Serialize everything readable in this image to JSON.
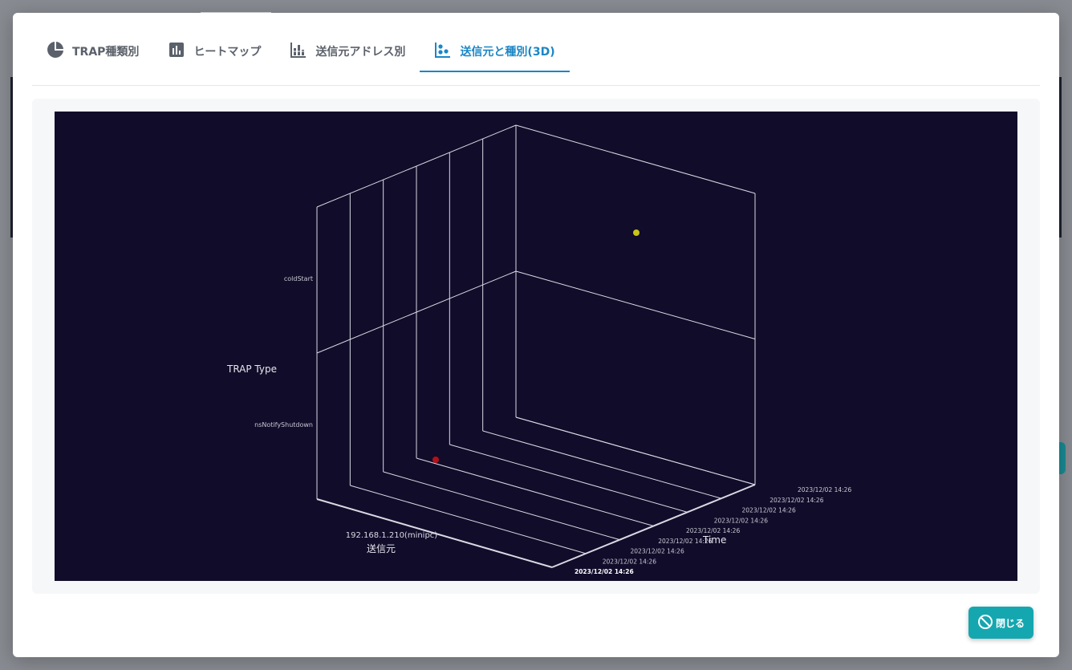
{
  "tabs": [
    {
      "label": "TRAP種類別",
      "icon": "pie-chart-icon"
    },
    {
      "label": "ヒートマップ",
      "icon": "bar-chart-icon"
    },
    {
      "label": "送信元アドレス別",
      "icon": "stacked-bar-icon"
    },
    {
      "label": "送信元と種別(3D)",
      "icon": "scatter-icon"
    }
  ],
  "active_tab": 3,
  "close_button": {
    "label": "閉じる"
  },
  "colors": {
    "accent": "#1b86c6",
    "close_button": "#15a7b0",
    "plot_bg": "#110c2a"
  },
  "chart_data": {
    "type": "scatter",
    "dimensions": "3d",
    "y_axis": {
      "label": "TRAP Type",
      "ticks": [
        "coldStart",
        "nsNotifyShutdown"
      ]
    },
    "x_axis": {
      "label": "送信元",
      "ticks": [
        "192.168.1.210(minipc)"
      ]
    },
    "z_axis": {
      "label": "Time",
      "ticks": [
        "2023/12/02 14:26",
        "2023/12/02 14:26",
        "2023/12/02 14:26",
        "2023/12/02 14:26",
        "2023/12/02 14:26",
        "2023/12/02 14:26",
        "2023/12/02 14:26",
        "2023/12/02 14:26",
        "2023/12/02 14:26"
      ]
    },
    "points": [
      {
        "sender": "192.168.1.210(minipc)",
        "trap_type": "coldStart",
        "time": "2023/12/02 14:26",
        "color": "#c9c41a"
      },
      {
        "sender": "192.168.1.210(minipc)",
        "trap_type": "nsNotifyShutdown",
        "time": "2023/12/02 14:26",
        "color": "#b5101a"
      }
    ],
    "grid": true
  }
}
